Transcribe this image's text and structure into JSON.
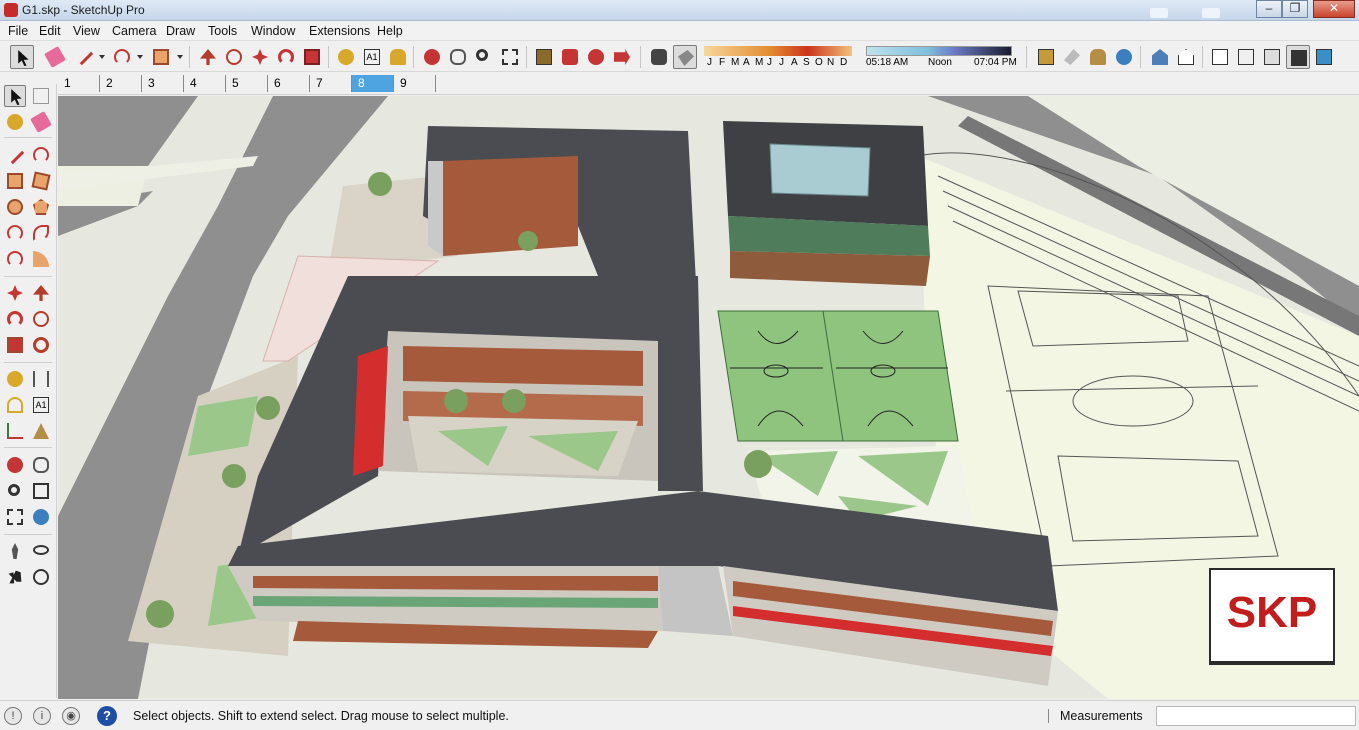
{
  "window": {
    "title": "G1.skp - SketchUp Pro"
  },
  "menu": [
    "File",
    "Edit",
    "View",
    "Camera",
    "Draw",
    "Tools",
    "Window",
    "Extensions",
    "Help"
  ],
  "shadow": {
    "months": [
      "J",
      "F",
      "M",
      "A",
      "M",
      "J",
      "J",
      "A",
      "S",
      "O",
      "N",
      "D"
    ],
    "time_start": "05:18 AM",
    "time_mid": "Noon",
    "time_end": "07:04 PM"
  },
  "scenes": {
    "tabs": [
      "1",
      "2",
      "3",
      "4",
      "5",
      "6",
      "7",
      "8",
      "9"
    ],
    "active": "8"
  },
  "badge": {
    "text": "SKP"
  },
  "status": {
    "prompt": "Select objects. Shift to extend select. Drag mouse to select multiple.",
    "measurements_label": "Measurements",
    "measurements_value": ""
  },
  "colors": {
    "roof": "#4a4c52",
    "grass": "#9ccb7a",
    "court": "#8fc47e",
    "ground": "#e8ebe1",
    "track": "#f4f7e6",
    "brick": "#a55b3b",
    "glass": "#4f7d5c",
    "paving": "#d8d2c5",
    "skp_red": "#c21d1d"
  }
}
